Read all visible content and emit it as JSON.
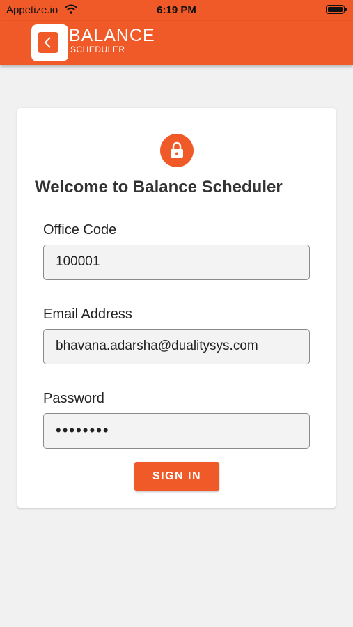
{
  "status_bar": {
    "carrier": "Appetize.io",
    "time": "6:19 PM",
    "wifi_icon": "wifi-icon",
    "battery_icon": "battery-icon"
  },
  "header": {
    "brand_name": "BALANCE",
    "brand_subtitle": "SCHEDULER",
    "logo_icon": "balance-logo-icon",
    "background_color": "#f05a28"
  },
  "login": {
    "lock_icon": "lock-icon",
    "title": "Welcome to Balance Scheduler",
    "office_code": {
      "label": "Office Code",
      "value": "100001"
    },
    "email": {
      "label": "Email Address",
      "value": "bhavana.adarsha@dualitysys.com"
    },
    "password": {
      "label": "Password",
      "value": "••••••••"
    },
    "sign_in_label": "SIGN IN",
    "accent_color": "#f05a28"
  }
}
